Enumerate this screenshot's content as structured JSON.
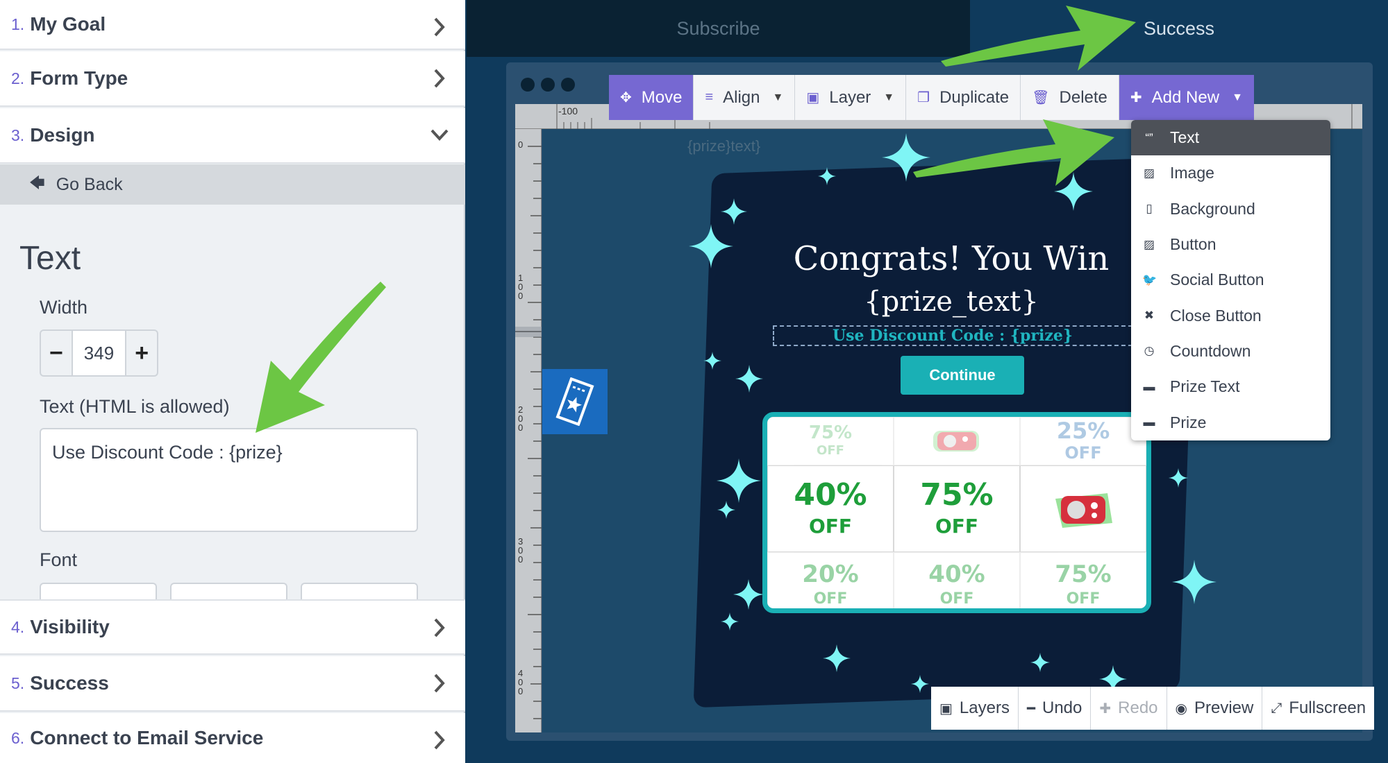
{
  "sidebar": {
    "sections": [
      {
        "num": "1.",
        "label": "My Goal"
      },
      {
        "num": "2.",
        "label": "Form Type"
      },
      {
        "num": "3.",
        "label": "Design"
      },
      {
        "num": "4.",
        "label": "Visibility"
      },
      {
        "num": "5.",
        "label": "Success"
      },
      {
        "num": "6.",
        "label": "Connect to Email Service"
      }
    ],
    "go_back": "Go Back",
    "panel_title": "Text",
    "width_label": "Width",
    "width_value": "349",
    "minus": "−",
    "plus": "+",
    "text_label": "Text (HTML is allowed)",
    "text_value": "Use Discount Code : {prize}",
    "font_label": "Font"
  },
  "tabs": {
    "subscribe": "Subscribe",
    "success": "Success"
  },
  "toolbar": {
    "move": "Move",
    "align": "Align",
    "layer": "Layer",
    "duplicate": "Duplicate",
    "delete": "Delete",
    "add_new": "Add New"
  },
  "ruler": {
    "top_label": "-100",
    "left_labels": [
      "0",
      "1\n0\n0",
      "2\n0\n0",
      "3\n0\n0",
      "4\n0\n0"
    ]
  },
  "add_menu": {
    "items": [
      {
        "label": "Text",
        "icon": "quote-icon"
      },
      {
        "label": "Image",
        "icon": "image-icon"
      },
      {
        "label": "Background",
        "icon": "page-icon"
      },
      {
        "label": "Button",
        "icon": "image-icon"
      },
      {
        "label": "Social Button",
        "icon": "twitter-icon"
      },
      {
        "label": "Close Button",
        "icon": "close-icon"
      },
      {
        "label": "Countdown",
        "icon": "clock-icon"
      },
      {
        "label": "Prize Text",
        "icon": "briefcase-icon"
      },
      {
        "label": "Prize",
        "icon": "briefcase-icon"
      }
    ]
  },
  "popup": {
    "placeholder": "{prize}text}",
    "title_line1": "Congrats! You Win",
    "title_line2": "{prize_text}",
    "discount": "Use Discount Code : {prize}",
    "continue": "Continue",
    "prizes": [
      {
        "pct": "75%",
        "off": "OFF"
      },
      {
        "pct": "",
        "off": ""
      },
      {
        "pct": "25%",
        "off": "OFF"
      },
      {
        "pct": "40%",
        "off": "OFF"
      },
      {
        "pct": "75%",
        "off": "OFF"
      },
      {
        "pct": "",
        "off": ""
      },
      {
        "pct": "20%",
        "off": "OFF"
      },
      {
        "pct": "40%",
        "off": "OFF"
      },
      {
        "pct": "75%",
        "off": "OFF"
      }
    ]
  },
  "bottom_toolbar": {
    "layers": "Layers",
    "undo": "Undo",
    "redo": "Redo",
    "preview": "Preview",
    "fullscreen": "Fullscreen"
  },
  "colors": {
    "accent_purple": "#7668d2",
    "canvas_bg": "#1d4a6a",
    "popup_bg": "#0b1d38",
    "teal": "#1ab0b5",
    "arrow_green": "#6cc644"
  }
}
